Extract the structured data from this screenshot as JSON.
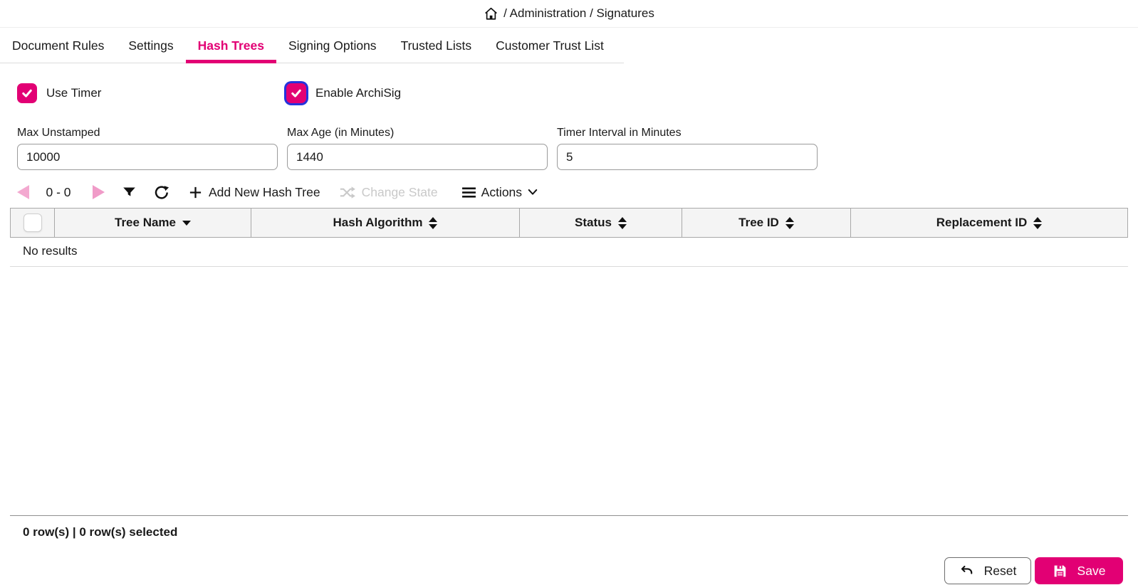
{
  "colors": {
    "magenta": "#e20074",
    "focus_blue": "#2433dd",
    "disabled_pink": "#f3a9d0",
    "disabled_gray": "#c9c9c9",
    "header_bg": "#f4f4f4"
  },
  "breadcrumb": {
    "home_icon": "home-icon",
    "path": "/ Administration / Signatures"
  },
  "tabs": [
    {
      "label": "Document Rules",
      "active": false
    },
    {
      "label": "Settings",
      "active": false
    },
    {
      "label": "Hash Trees",
      "active": true
    },
    {
      "label": "Signing Options",
      "active": false
    },
    {
      "label": "Trusted Lists",
      "active": false
    },
    {
      "label": "Customer Trust List",
      "active": false
    }
  ],
  "settings": {
    "checkboxes": [
      {
        "label": "Use Timer",
        "checked": true,
        "focused": false
      },
      {
        "label": "Enable ArchiSig",
        "checked": true,
        "focused": true
      }
    ],
    "fields": [
      {
        "label": "Max Unstamped",
        "value": "10000"
      },
      {
        "label": "Max Age (in Minutes)",
        "value": "1440"
      },
      {
        "label": "Timer Interval in Minutes",
        "value": "5"
      }
    ]
  },
  "toolbar": {
    "pagination": "0 - 0",
    "add_new": "Add New Hash Tree",
    "change_state": "Change State",
    "change_state_enabled": false,
    "actions": "Actions"
  },
  "table": {
    "columns": [
      {
        "label": "Tree Name",
        "sort": "desc"
      },
      {
        "label": "Hash Algorithm",
        "sort": "both"
      },
      {
        "label": "Status",
        "sort": "both"
      },
      {
        "label": "Tree ID",
        "sort": "both"
      },
      {
        "label": "Replacement ID",
        "sort": "both"
      }
    ],
    "empty": "No results"
  },
  "status_bar": {
    "text": "0 row(s) | 0 row(s) selected"
  },
  "buttons": {
    "reset": "Reset",
    "save": "Save"
  }
}
